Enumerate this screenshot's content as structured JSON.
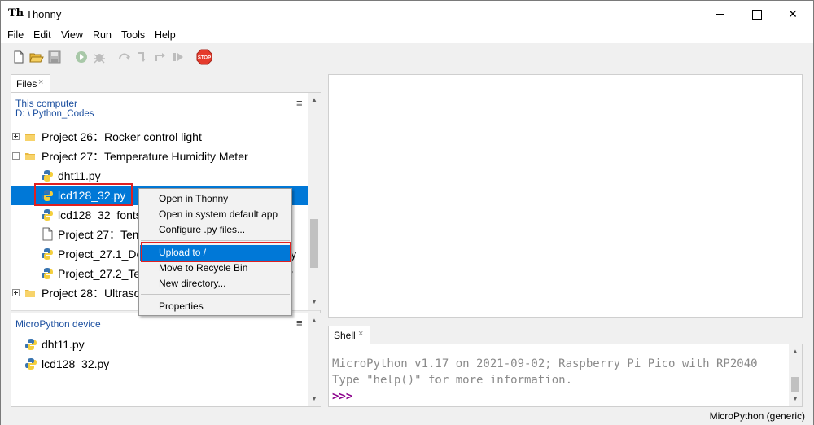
{
  "window": {
    "title": "Thonny",
    "app_icon": "Th"
  },
  "menubar": [
    "File",
    "Edit",
    "View",
    "Run",
    "Tools",
    "Help"
  ],
  "toolbar": {
    "icons": [
      "new-file-icon",
      "open-file-icon",
      "save-icon",
      "run-icon",
      "debug-icon",
      "step-over-icon",
      "step-into-icon",
      "step-out-icon",
      "resume-icon",
      "stop-icon"
    ],
    "stop_label": "STOP"
  },
  "files_tab": {
    "label": "Files",
    "close": "×"
  },
  "computer": {
    "title": "This computer",
    "path": "D: \\ Python_Codes",
    "menu": "≡",
    "tree": [
      {
        "label": "Project 26：Rocker control light",
        "kind": "folder",
        "state": "collapsed"
      },
      {
        "label": "Project 27：Temperature Humidity Meter",
        "kind": "folder",
        "state": "expanded"
      },
      {
        "label": "dht11.py",
        "kind": "py"
      },
      {
        "label": "lcd128_32.py",
        "kind": "py",
        "selected": true
      },
      {
        "label": "lcd128_32_fonts.py",
        "kind": "py"
      },
      {
        "label": "Project 27：Temperature Humidity Meter.docx",
        "kind": "doc"
      },
      {
        "label": "Project_27.1_Detect_Temperature_Humidity.py",
        "kind": "py"
      },
      {
        "label": "Project_27.2_Temperature_Humidity_Meter.py",
        "kind": "py"
      },
      {
        "label": "Project 28：Ultrasonic Ranger",
        "kind": "folder",
        "state": "collapsed"
      }
    ]
  },
  "device": {
    "title": "MicroPython device",
    "menu": "≡",
    "files": [
      "dht11.py",
      "lcd128_32.py"
    ]
  },
  "context_menu": {
    "items": [
      "Open in Thonny",
      "Open in system default app",
      "Configure .py files...",
      "Upload to /",
      "Move to Recycle Bin",
      "New directory...",
      "Properties"
    ],
    "active_item": "Upload to /"
  },
  "shell": {
    "tab_label": "Shell",
    "close": "×",
    "lines": [
      "MicroPython v1.17 on 2021-09-02; Raspberry Pi Pico with RP2040",
      "Type \"help()\" for more information."
    ],
    "prompt": ">>>"
  },
  "status": {
    "interpreter": "MicroPython (generic)"
  },
  "colors": {
    "selection": "#0078d7",
    "highlight_box": "#e02020",
    "prompt": "#8b008b",
    "link_text": "#1a4e9f"
  }
}
